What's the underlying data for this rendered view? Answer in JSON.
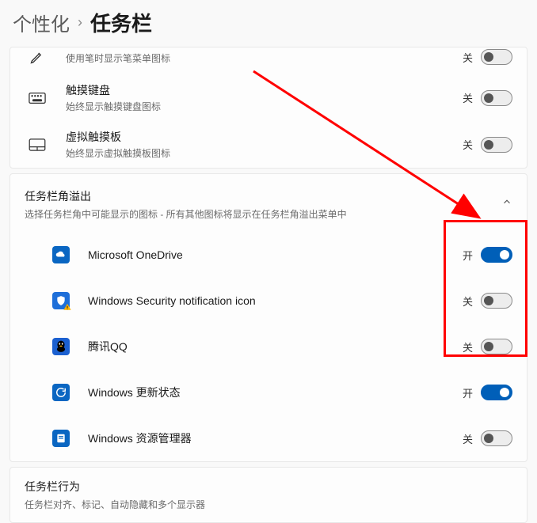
{
  "breadcrumb": {
    "parent": "个性化",
    "sep": "›",
    "current": "任务栏"
  },
  "top_rows": [
    {
      "key": "pen",
      "title": "",
      "sub": "使用笔时显示笔菜单图标",
      "state": "关",
      "on": false
    },
    {
      "key": "touchkb",
      "title": "触摸键盘",
      "sub": "始终显示触摸键盘图标",
      "state": "关",
      "on": false
    },
    {
      "key": "vtouchpad",
      "title": "虚拟触摸板",
      "sub": "始终显示虚拟触摸板图标",
      "state": "关",
      "on": false
    }
  ],
  "overflow_section": {
    "title": "任务栏角溢出",
    "sub": "选择任务栏角中可能显示的图标 - 所有其他图标将显示在任务栏角溢出菜单中",
    "items": [
      {
        "key": "onedrive",
        "label": "Microsoft OneDrive",
        "state": "开",
        "on": true,
        "bg": "#0a66c2"
      },
      {
        "key": "winsec",
        "label": "Windows Security notification icon",
        "state": "关",
        "on": false,
        "bg": "#1e6fd9"
      },
      {
        "key": "qq",
        "label": "腾讯QQ",
        "state": "关",
        "on": false,
        "bg": "#1b60d0"
      },
      {
        "key": "winupd",
        "label": "Windows 更新状态",
        "state": "开",
        "on": true,
        "bg": "#0a66c2"
      },
      {
        "key": "explorer",
        "label": "Windows 资源管理器",
        "state": "关",
        "on": false,
        "bg": "#0a66c2"
      }
    ]
  },
  "behavior_section": {
    "title": "任务栏行为",
    "sub": "任务栏对齐、标记、自动隐藏和多个显示器"
  }
}
